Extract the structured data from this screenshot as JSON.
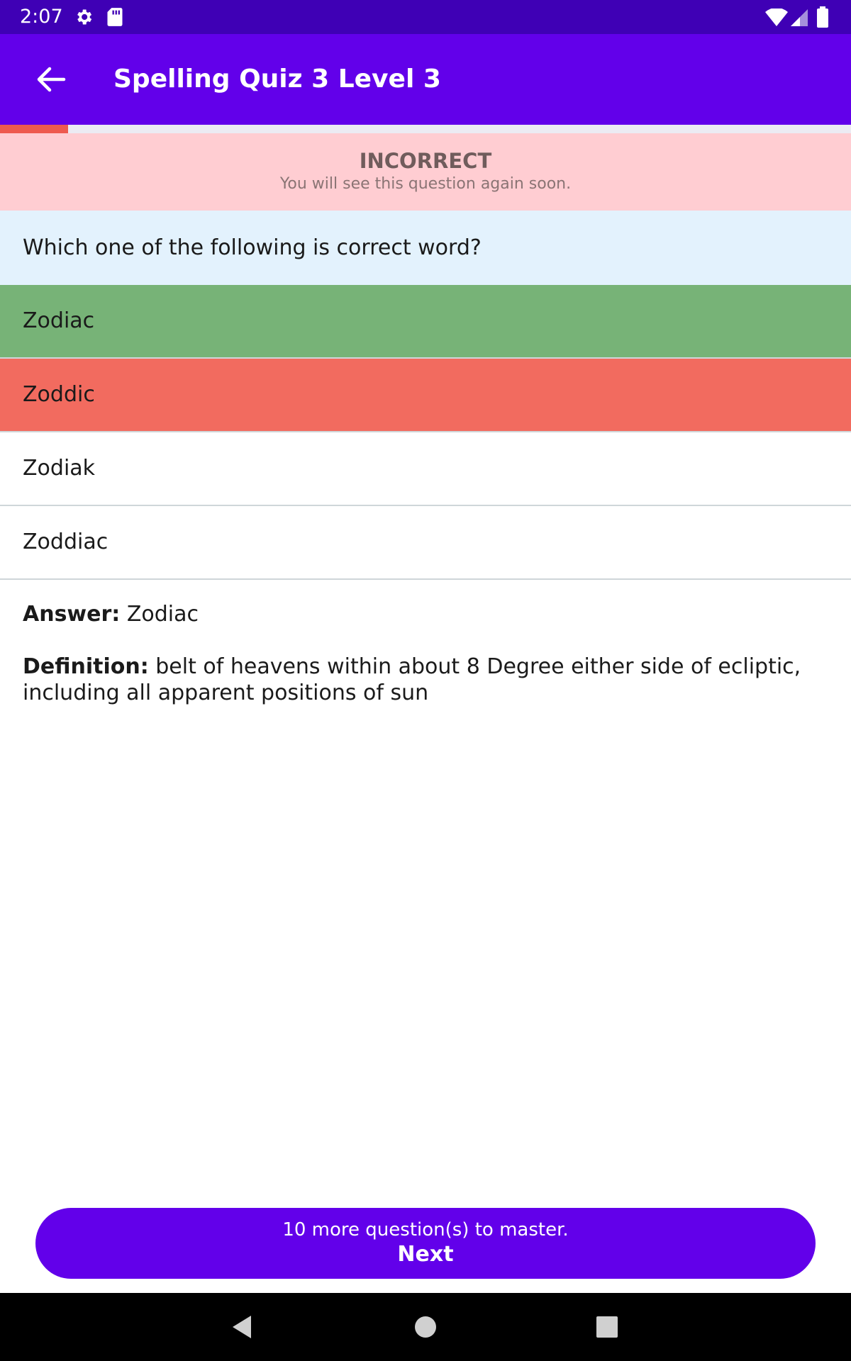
{
  "status_bar": {
    "time": "2:07",
    "icons": [
      "gear-icon",
      "sd-card-icon",
      "wifi-icon",
      "signal-icon",
      "battery-icon"
    ],
    "background": "#3f00b5"
  },
  "app_bar": {
    "title": "Spelling Quiz 3 Level 3",
    "back_icon": "arrow-left-icon",
    "background": "#6200ea"
  },
  "progress": {
    "fraction": 0.08,
    "fill_color": "#ee5a4f"
  },
  "feedback": {
    "title": "INCORRECT",
    "subtitle": "You will see this question again soon.",
    "background": "#ffcdd2"
  },
  "question": {
    "text": "Which one of the following is correct word?",
    "background": "#e3f2fd"
  },
  "options": [
    {
      "label": "Zodiac",
      "state": "correct"
    },
    {
      "label": "Zoddic",
      "state": "wrong"
    },
    {
      "label": "Zodiak",
      "state": "neutral"
    },
    {
      "label": "Zoddiac",
      "state": "neutral"
    }
  ],
  "explanation": {
    "answer_label": "Answer:",
    "answer_value": "Zodiac",
    "definition_label": "Definition:",
    "definition_value": "belt of heavens within about 8 Degree either side of ecliptic, including all apparent positions of sun"
  },
  "next_button": {
    "subtitle": "10 more question(s) to master.",
    "label": "Next",
    "background": "#6200ea"
  },
  "nav_bar": {
    "icons": [
      "back-triangle-icon",
      "home-circle-icon",
      "recents-square-icon"
    ]
  }
}
